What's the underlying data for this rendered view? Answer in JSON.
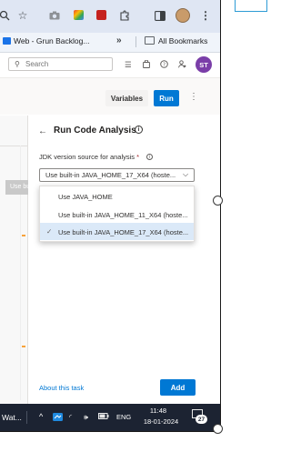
{
  "browser": {
    "bookmarks": {
      "web_item": "Web - Grun Backlog...",
      "more_label": "»",
      "all_bookmarks": "All Bookmarks"
    }
  },
  "ado": {
    "search_placeholder": "Search",
    "user_initials": "ST",
    "actionbar": {
      "variables_label": "Variables",
      "run_label": "Run"
    }
  },
  "tooltip_text": "Use buil",
  "panel": {
    "title": "Run Code Analysis",
    "field_label": "JDK version source for analysis",
    "required_marker": "*",
    "selected_value": "Use built-in JAVA_HOME_17_X64 (hoste...",
    "options": [
      {
        "label": "Use JAVA_HOME",
        "selected": false
      },
      {
        "label": "Use built-in JAVA_HOME_11_X64 (hoste...",
        "selected": false
      },
      {
        "label": "Use built-in JAVA_HOME_17_X64 (hoste...",
        "selected": true
      }
    ],
    "about_link": "About this task",
    "add_label": "Add"
  },
  "taskbar": {
    "app_label": "Wat...",
    "language": "ENG",
    "time": "11:48",
    "date": "18-01-2024",
    "notification_count": "27"
  },
  "colors": {
    "accent": "#0078d4",
    "avatar": "#7a3ea8",
    "taskbar": "#1c2332",
    "selected_option": "#dbe9f8"
  }
}
